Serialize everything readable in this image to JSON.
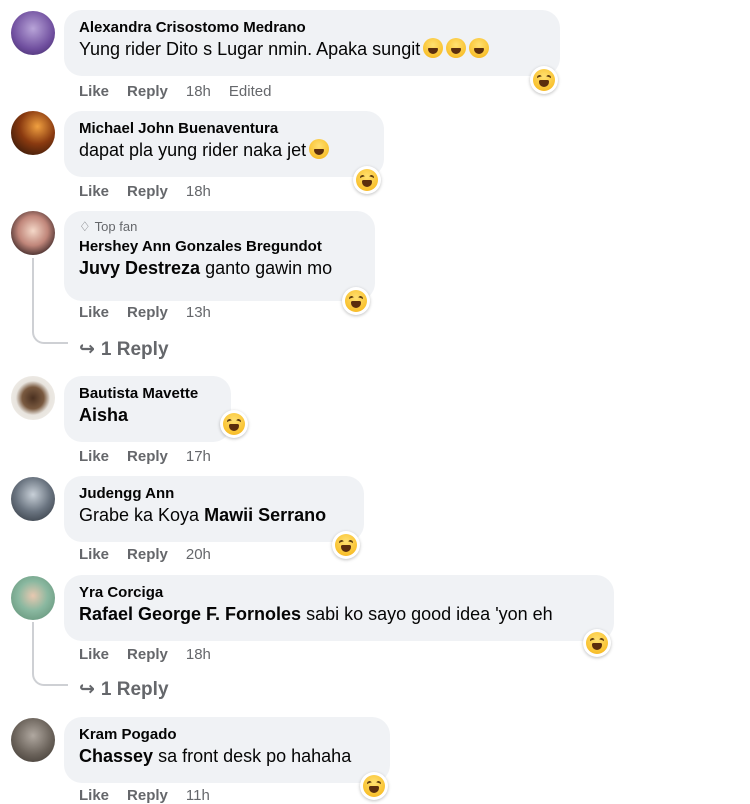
{
  "labels": {
    "like": "Like",
    "reply": "Reply",
    "edited": "Edited",
    "top_fan": "Top fan"
  },
  "comments": [
    {
      "author": "Alexandra Crisostomo Medrano",
      "text": "Yung rider Dito s Lugar nmin. Apaka sungit",
      "time": "18h",
      "edited": true
    },
    {
      "author": "Michael John Buenaventura",
      "text": "dapat pla yung rider naka jet",
      "time": "18h"
    },
    {
      "author": "Hershey Ann Gonzales Bregundot",
      "mention": "Juvy Destreza",
      "text": " ganto gawin mo",
      "time": "13h",
      "replies": "1 Reply"
    },
    {
      "author": "Bautista Mavette",
      "mention": "Aisha",
      "text": "",
      "time": "17h"
    },
    {
      "author": "Judengg Ann",
      "text": "Grabe ka Koya ",
      "mention_after": "Mawii Serrano",
      "time": "20h"
    },
    {
      "author": "Yra Corciga",
      "mention": "Rafael George F. Fornoles",
      "text": " sabi ko sayo good idea 'yon eh",
      "time": "18h",
      "replies": "1 Reply"
    },
    {
      "author": "Kram Pogado",
      "mention": "Chassey",
      "text": " sa front desk po hahaha",
      "time": "11h"
    }
  ],
  "icons": {
    "reaction": "haha-reaction-icon",
    "reply_arrow": "reply-arrow-icon",
    "top_fan": "diamond-icon"
  },
  "colors": {
    "bubble": "#f0f2f5",
    "meta": "#65676b",
    "text": "#050505"
  }
}
